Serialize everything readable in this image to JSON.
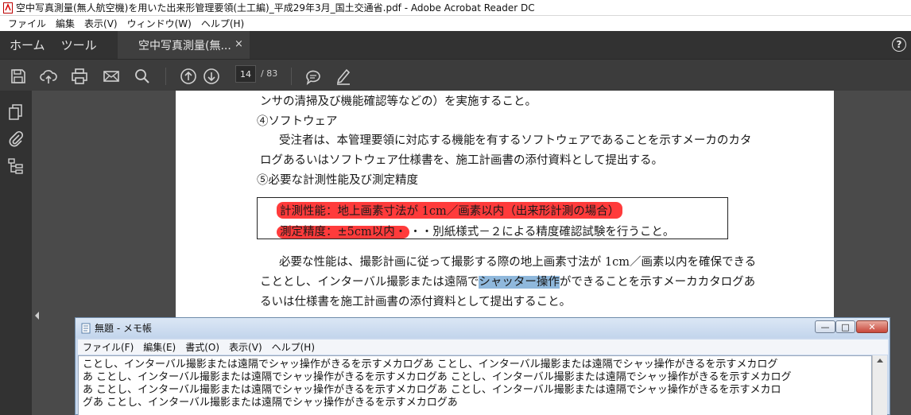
{
  "window": {
    "title": "空中写真測量(無人航空機)を用いた出来形管理要領(土工編)_平成29年3月_国土交通省.pdf - Adobe Acrobat Reader DC"
  },
  "menubar": {
    "items": [
      "ファイル",
      "編集",
      "表示(V)",
      "ウィンドウ(W)",
      "ヘルプ(H)"
    ]
  },
  "tabs": {
    "home": "ホーム",
    "tools": "ツール",
    "document": "空中写真測量(無...",
    "close": "×",
    "help": "?"
  },
  "toolbar": {
    "icons": [
      "save-icon",
      "upload-cloud-icon",
      "print-icon",
      "email-icon",
      "search-icon",
      "page-up-icon",
      "page-down-icon",
      "comment-icon",
      "pen-icon"
    ],
    "page_current": "14",
    "page_total": "/ 83"
  },
  "document": {
    "lines": {
      "l1": "ンサの清掃及び機能確認等などの）を実施すること。",
      "l2": "④ソフトウェア",
      "l3": "受注者は、本管理要領に対応する機能を有するソフトウェアであることを示すメーカのカタ",
      "l4": "ログあるいはソフトウェア仕様書を、施工計画書の添付資料として提出する。",
      "l5": "⑤必要な計測性能及び測定精度",
      "box1": "計測性能：地上画素寸法が 1cm／画素以内（出来形計測の場合）",
      "box2_hl": "測定精度：±5cm以内・",
      "box2_rest": "・・別紙様式－２による精度確認試験を行うこと。",
      "p1": "必要な性能は、撮影計画に従って撮影する際の地上画素寸法が 1cm／画素以内を確保できる",
      "p2a": "こととし、インターバル撮影または遠隔で",
      "p2hl": "シャッター操作",
      "p2b": "ができることを示すメーカカタログあ",
      "p3": "るいは仕様書を施工計画書の添付資料として提出すること。"
    }
  },
  "notepad": {
    "title": "無題 - メモ帳",
    "menu": [
      "ファイル(F)",
      "編集(E)",
      "書式(O)",
      "表示(V)",
      "ヘルプ(H)"
    ],
    "controls": {
      "minimize": "—",
      "maximize": "□",
      "close": "✕"
    },
    "text_lines": [
      "ことし、インターバル撮影または遠隔でシャッ操作がきるを示すメカログあ ことし、インターバル撮影または遠隔でシャッ操作がきるを示すメカログ",
      "あ ことし、インターバル撮影または遠隔でシャッ操作がきるを示すメカログあ ことし、インターバル撮影または遠隔でシャッ操作がきるを示すメカログ",
      "あ ことし、インターバル撮影または遠隔でシャッ操作がきるを示すメカログあ ことし、インターバル撮影または遠隔でシャッ操作がきるを示すメカロ",
      "グあ ことし、インターバル撮影または遠隔でシャッ操作がきるを示すメカログあ"
    ]
  },
  "colors": {
    "highlight_red": "#ff3b3b",
    "highlight_blue": "#8fb8dc",
    "acrobat_dark": "#323232"
  }
}
